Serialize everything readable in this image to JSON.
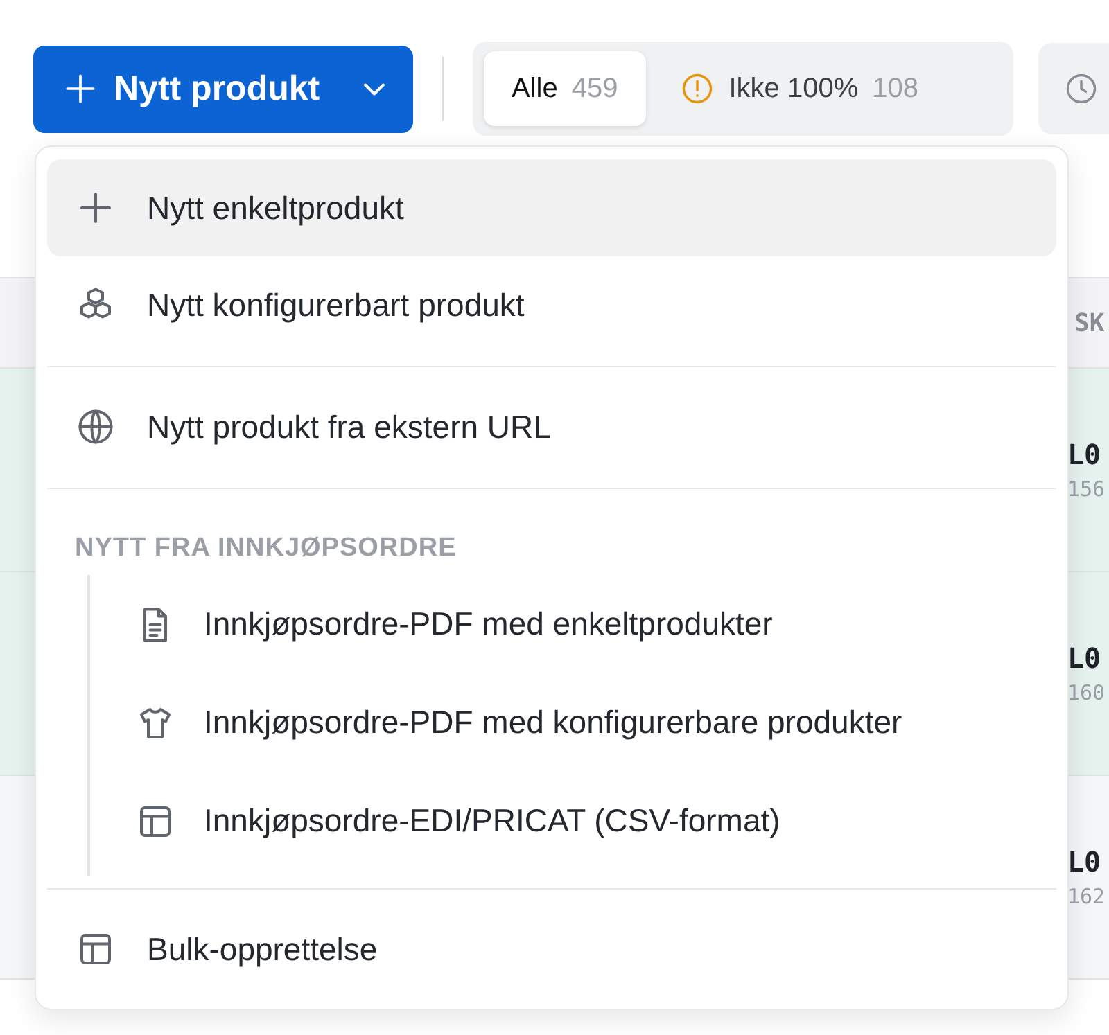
{
  "toolbar": {
    "new_button": {
      "label": "Nytt produkt"
    },
    "filter_tabs": [
      {
        "kind": "plain",
        "label": "Alle",
        "count": "459",
        "selected": true
      },
      {
        "kind": "warning",
        "label": "Ikke 100%",
        "count": "108",
        "selected": false
      },
      {
        "kind": "clock",
        "selected": false
      }
    ]
  },
  "table": {
    "columns": [
      "SK"
    ],
    "rows": [
      {
        "cells": [
          "L0",
          "156"
        ],
        "selected": true
      },
      {
        "cells": [
          "L0",
          "160"
        ],
        "selected": true
      },
      {
        "cells": [
          "L0",
          "162"
        ],
        "selected": false
      }
    ]
  },
  "menu": {
    "entries": [
      {
        "kind": "item",
        "label": "Nytt enkeltprodukt",
        "selected": true
      },
      {
        "kind": "item",
        "label": "Nytt konfigurerbart produkt",
        "selected": false
      },
      {
        "kind": "divider"
      },
      {
        "kind": "item",
        "label": "Nytt produkt fra ekstern URL",
        "selected": false
      },
      {
        "kind": "divider"
      },
      {
        "kind": "section",
        "title": "NYTT FRA INNKJØPSORDRE",
        "children": [
          {
            "label": "Innkjøpsordre-PDF med enkeltprodukter",
            "selected": false
          },
          {
            "label": "Innkjøpsordre-PDF med konfigurerbare produkter",
            "selected": false
          },
          {
            "label": "Innkjøpsordre-EDI/PRICAT (CSV-format)",
            "selected": false
          }
        ]
      },
      {
        "kind": "divider"
      },
      {
        "kind": "item",
        "label": "Bulk-opprettelse",
        "selected": false
      }
    ]
  }
}
